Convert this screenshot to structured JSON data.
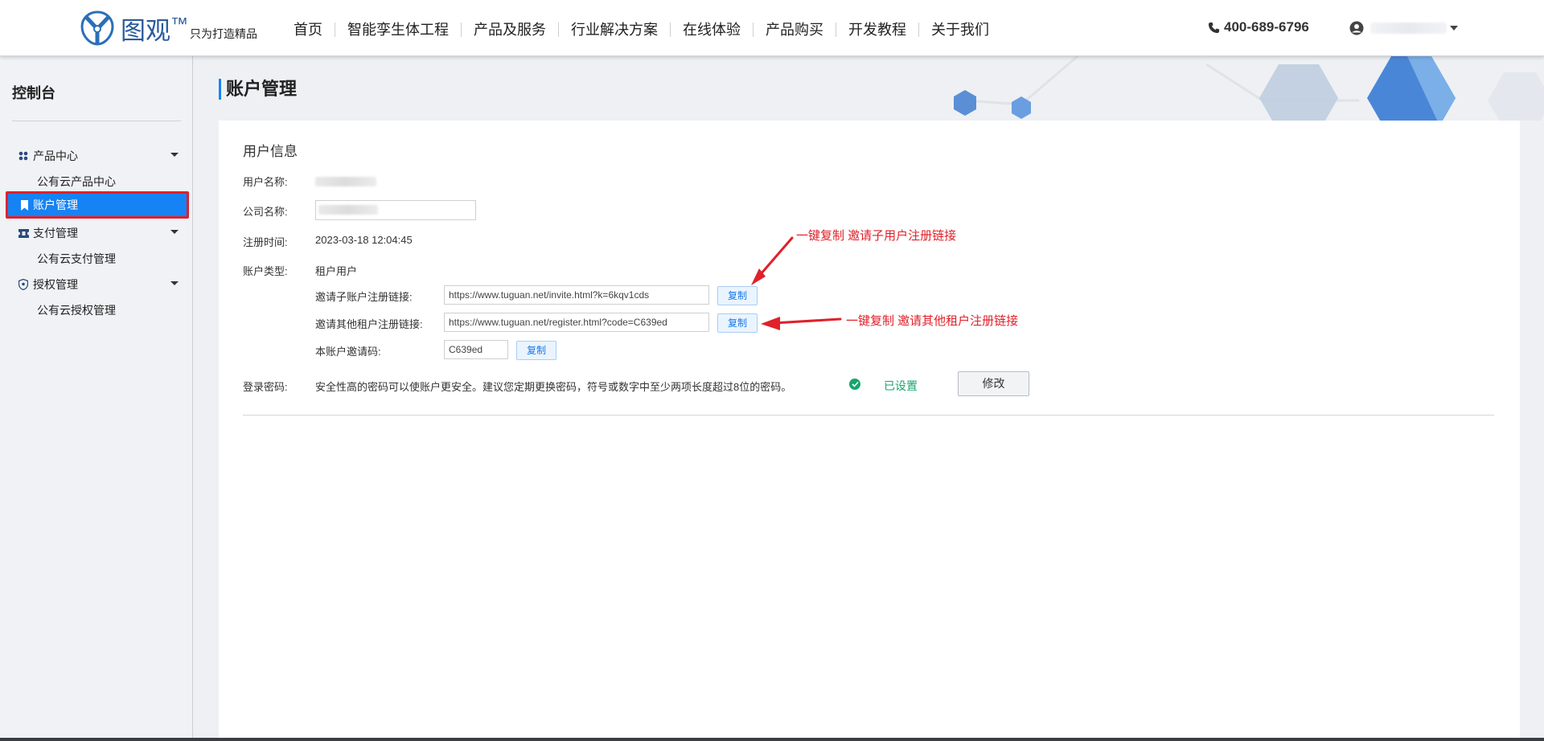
{
  "header": {
    "logo_name": "图观",
    "logo_tm": "™",
    "logo_slogan": "只为打造精品",
    "nav": [
      "首页",
      "智能孪生体工程",
      "产品及服务",
      "行业解决方案",
      "在线体验",
      "产品购买",
      "开发教程",
      "关于我们"
    ],
    "phone": "400-689-6796"
  },
  "sidebar": {
    "title": "控制台",
    "groups": [
      {
        "label": "产品中心",
        "icon": "grid-icon",
        "sub": "公有云产品中心"
      },
      {
        "label": "账户管理",
        "icon": "bookmark-icon",
        "active": true
      },
      {
        "label": "支付管理",
        "icon": "ticket-icon",
        "sub": "公有云支付管理"
      },
      {
        "label": "授权管理",
        "icon": "shield-icon",
        "sub": "公有云授权管理"
      }
    ]
  },
  "main": {
    "page_title": "账户管理",
    "section_title": "用户信息",
    "fields": {
      "username_label": "用户名称:",
      "company_label": "公司名称:",
      "reg_time_label": "注册时间:",
      "reg_time": "2023-03-18 12:04:45",
      "account_type_label": "账户类型:",
      "account_type": "租户用户",
      "invite_sub_label": "邀请子账户注册链接:",
      "invite_sub_url": "https://www.tuguan.net/invite.html?k=6kqv1cds",
      "invite_tenant_label": "邀请其他租户注册链接:",
      "invite_tenant_url": "https://www.tuguan.net/register.html?code=C639ed",
      "invite_code_label": "本账户邀请码:",
      "invite_code": "C639ed",
      "copy_label": "复制",
      "password_label": "登录密码:",
      "password_hint": "安全性高的密码可以使账户更安全。建议您定期更换密码，符号或数字中至少两项长度超过8位的密码。",
      "password_status": "已设置",
      "modify_label": "修改"
    },
    "annotations": {
      "sub_link": "一键复制 邀请子用户注册链接",
      "tenant_link": "一键复制 邀请其他租户注册链接"
    }
  },
  "colors": {
    "accent": "#1683f5",
    "highlight_border": "#e0202a",
    "success": "#17a56b",
    "annotation": "#e0202a"
  }
}
